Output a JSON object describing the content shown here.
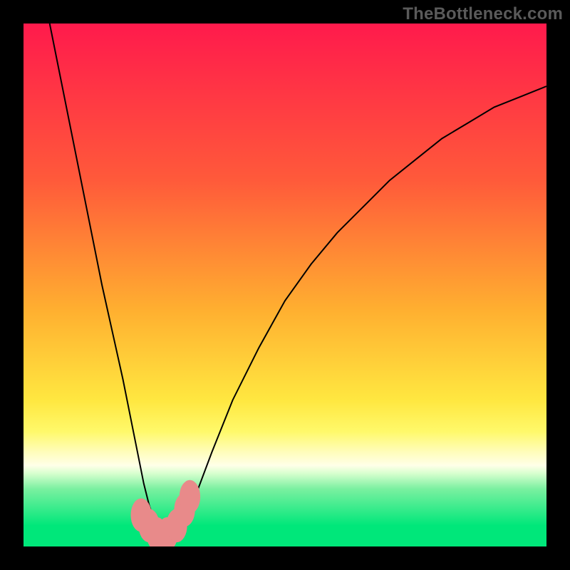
{
  "watermark": "TheBottleneck.com",
  "chart_data": {
    "type": "line",
    "title": "",
    "xlabel": "",
    "ylabel": "",
    "xlim": [
      0,
      100
    ],
    "ylim": [
      0,
      100
    ],
    "background_gradient": [
      {
        "stop": 0,
        "color": "#ff1a4c"
      },
      {
        "stop": 30,
        "color": "#ff5a3a"
      },
      {
        "stop": 55,
        "color": "#ffb030"
      },
      {
        "stop": 72,
        "color": "#ffe740"
      },
      {
        "stop": 78,
        "color": "#fff96a"
      },
      {
        "stop": 82,
        "color": "#fffdbc"
      },
      {
        "stop": 84.5,
        "color": "#ffffe8"
      },
      {
        "stop": 86,
        "color": "#d8ffcf"
      },
      {
        "stop": 89,
        "color": "#7af0a0"
      },
      {
        "stop": 96,
        "color": "#00e77a"
      },
      {
        "stop": 100,
        "color": "#00e77a"
      }
    ],
    "series": [
      {
        "name": "curve",
        "color": "#000000",
        "width": 2,
        "x": [
          5,
          7,
          9,
          11,
          13,
          15,
          17,
          19,
          20,
          21,
          22,
          23,
          24,
          25,
          26,
          27,
          28,
          29,
          30,
          31,
          33,
          36,
          40,
          45,
          50,
          55,
          60,
          65,
          70,
          75,
          80,
          85,
          90,
          95,
          100
        ],
        "y": [
          100,
          90,
          80,
          70,
          60,
          50,
          41,
          32,
          27,
          22,
          17,
          12,
          8,
          5,
          3,
          2,
          2,
          2,
          3,
          5,
          10,
          18,
          28,
          38,
          47,
          54,
          60,
          65,
          70,
          74,
          78,
          81,
          84,
          86,
          88
        ]
      }
    ],
    "dots": {
      "color": "#e88a8a",
      "radius_w": 2.0,
      "radius_h": 3.2,
      "points": [
        {
          "x": 22.5,
          "y": 6.0
        },
        {
          "x": 24.0,
          "y": 4.0
        },
        {
          "x": 25.5,
          "y": 2.4
        },
        {
          "x": 27.5,
          "y": 2.4
        },
        {
          "x": 29.3,
          "y": 4.0
        },
        {
          "x": 30.8,
          "y": 7.0
        },
        {
          "x": 31.8,
          "y": 9.5
        }
      ]
    }
  }
}
